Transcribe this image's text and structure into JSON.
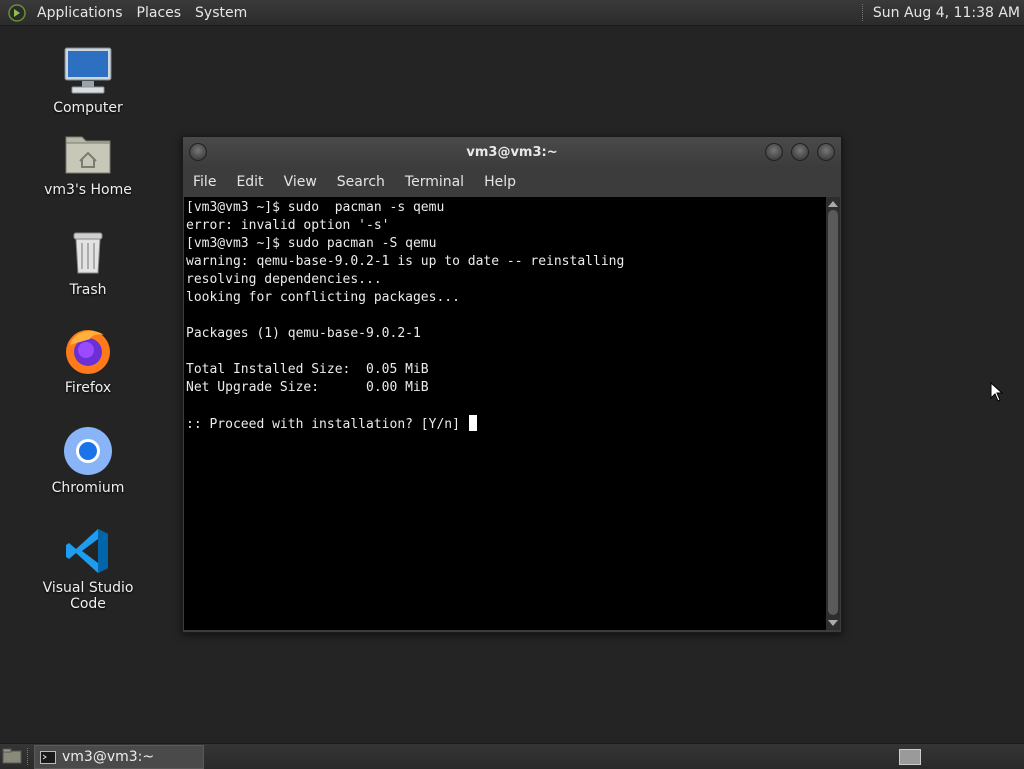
{
  "top_panel": {
    "menus": [
      "Applications",
      "Places",
      "System"
    ],
    "clock": "Sun Aug  4, 11:38 AM"
  },
  "desktop": {
    "icons": [
      {
        "label": "Computer",
        "icon": "computer-icon"
      },
      {
        "label": "vm3's Home",
        "icon": "home-folder-icon"
      },
      {
        "label": "Trash",
        "icon": "trash-icon"
      },
      {
        "label": "Firefox",
        "icon": "firefox-icon"
      },
      {
        "label": "Chromium",
        "icon": "chromium-icon"
      },
      {
        "label": "Visual Studio Code",
        "icon": "vscode-icon"
      }
    ]
  },
  "terminal": {
    "title": "vm3@vm3:~",
    "menu": [
      "File",
      "Edit",
      "View",
      "Search",
      "Terminal",
      "Help"
    ],
    "lines": [
      "[vm3@vm3 ~]$ sudo  pacman -s qemu",
      "error: invalid option '-s'",
      "[vm3@vm3 ~]$ sudo pacman -S qemu",
      "warning: qemu-base-9.0.2-1 is up to date -- reinstalling",
      "resolving dependencies...",
      "looking for conflicting packages...",
      "",
      "Packages (1) qemu-base-9.0.2-1",
      "",
      "Total Installed Size:  0.05 MiB",
      "Net Upgrade Size:      0.00 MiB",
      "",
      ":: Proceed with installation? [Y/n] "
    ]
  },
  "taskbar": {
    "task_label": "vm3@vm3:~"
  }
}
